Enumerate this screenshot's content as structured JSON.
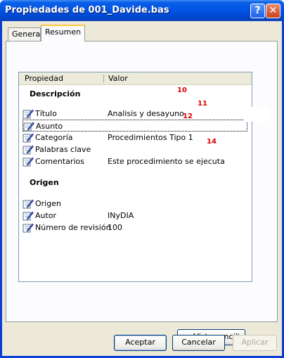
{
  "window": {
    "title": "Propiedades de 001_Davide.bas"
  },
  "tabs": [
    {
      "label": "General"
    },
    {
      "label": "Resumen"
    }
  ],
  "grid": {
    "headers": {
      "property": "Propiedad",
      "value": "Valor"
    },
    "sections": [
      {
        "title": "Descripción",
        "rows": [
          {
            "label": "Título",
            "value": "Analisis y desayuno",
            "marker": "10"
          },
          {
            "label": "Asunto",
            "value": "",
            "marker": "11"
          },
          {
            "label": "Categoría",
            "value": "Procedimientos Tipo 1",
            "marker": "12"
          },
          {
            "label": "Palabras clave",
            "value": ""
          },
          {
            "label": "Comentarios",
            "value": "Este procedimiento se ejecuta",
            "marker": "14"
          }
        ]
      },
      {
        "title": "Origen",
        "rows": [
          {
            "label": "Origen",
            "value": ""
          },
          {
            "label": "Autor",
            "value": "INyDIA"
          },
          {
            "label": "Número de revisión",
            "value": "100"
          }
        ]
      }
    ]
  },
  "buttons": {
    "simple_view": "<< Vista sencilla",
    "accept": "Aceptar",
    "cancel": "Cancelar",
    "apply": "Aplicar"
  },
  "icons": {
    "help": "help-icon",
    "close": "close-icon",
    "property": "edit-property-icon"
  }
}
